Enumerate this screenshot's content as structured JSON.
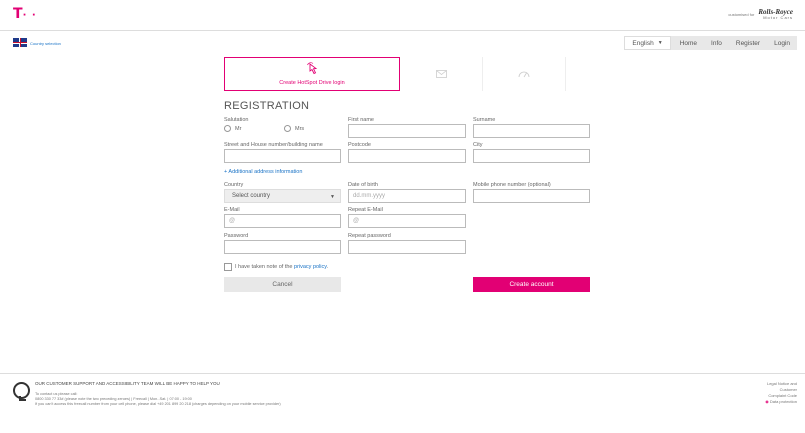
{
  "header": {
    "logo": "T",
    "logo_dots": "· ·",
    "customised_for": "customised for",
    "brand_name": "Rolls-Royce",
    "brand_sub": "Motor Cars"
  },
  "subbar": {
    "country_selection": "Country selection",
    "nav": {
      "language": "English",
      "home": "Home",
      "info": "Info",
      "register": "Register",
      "login": "Login"
    }
  },
  "tabs": {
    "active_label": "Create HotSpot Drive login",
    "icons": [
      "cursor-tap-icon",
      "email-icon",
      "speedometer-icon"
    ]
  },
  "form": {
    "title": "REGISTRATION",
    "salutation": "Salutation",
    "mr": "Mr",
    "mrs": "Mrs",
    "first_name": "First name",
    "surname": "Surname",
    "street": "Street and House number/building name",
    "postcode": "Postcode",
    "city": "City",
    "additional_address": "+ Additional address information",
    "country": "Country",
    "select_country": "Select country",
    "dob": "Date of birth",
    "dob_placeholder": "dd.mm.yyyy",
    "mobile": "Mobile phone number (optional)",
    "email": "E-Mail",
    "repeat_email": "Repeat E-Mail",
    "at_placeholder": "@",
    "password": "Password",
    "repeat_password": "Repeat password",
    "privacy_prefix": "I have taken note of the ",
    "privacy_link": "privacy policy",
    "privacy_suffix": ".",
    "cancel": "Cancel",
    "create_account": "Create account"
  },
  "footer": {
    "title": "Our customer support and accessibility team will be happy to help you",
    "line1": "To contact us please call:",
    "line2": "0800 330 77 33# (please note the two preceding zeroes) | Freecall | Mon.-Sat. | 07:00 - 19:00",
    "line3": "If you can't access this freecall number from your cell phone, please dial +49 201 899 20 218 (charges depending on your mobile service provider)",
    "legal": [
      "Legal Notice and",
      "Customer",
      "Complaint Code"
    ],
    "data_protection": "Data protection"
  },
  "colors": {
    "magenta": "#e20074",
    "link": "#1a73c6"
  }
}
